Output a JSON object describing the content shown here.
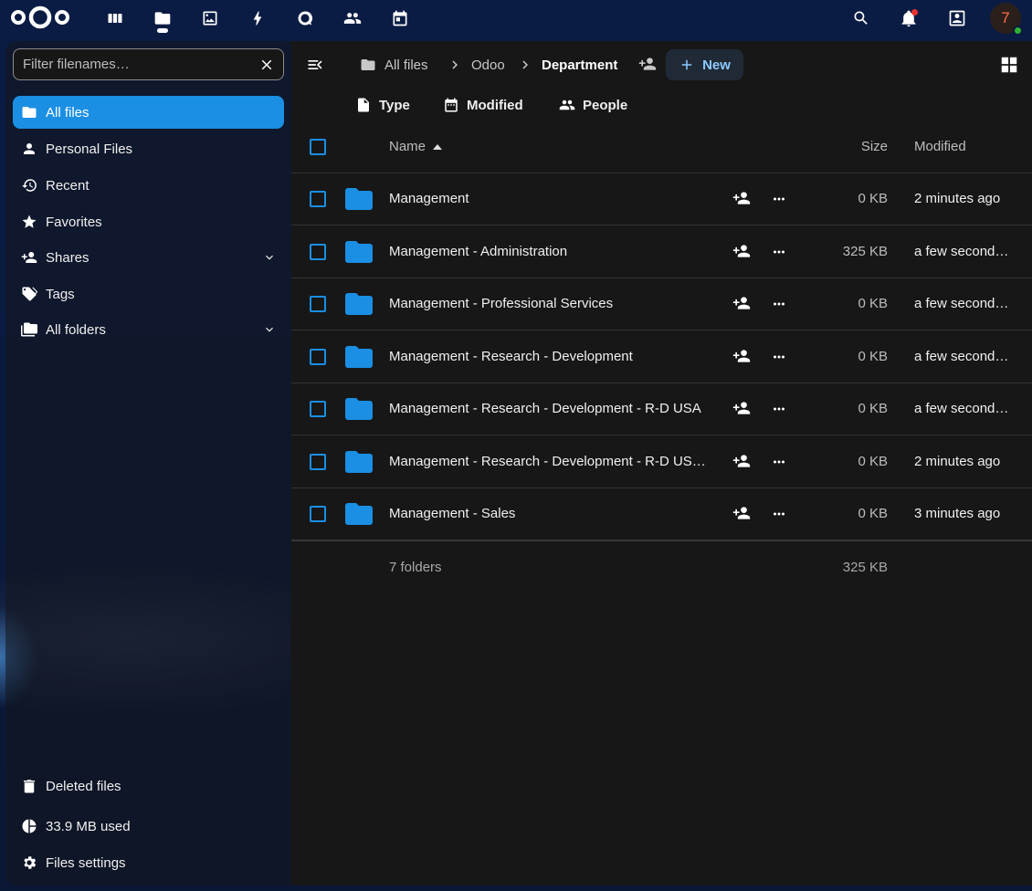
{
  "apps": [
    {
      "name": "dashboard"
    },
    {
      "name": "files"
    },
    {
      "name": "photos"
    },
    {
      "name": "activity"
    },
    {
      "name": "talk"
    },
    {
      "name": "contacts"
    },
    {
      "name": "calendar"
    }
  ],
  "header": {
    "avatar_initial": "7"
  },
  "sidebar": {
    "filter_placeholder": "Filter filenames…",
    "items": [
      {
        "label": "All files",
        "icon": "folder-icon",
        "active": true
      },
      {
        "label": "Personal Files",
        "icon": "account-icon"
      },
      {
        "label": "Recent",
        "icon": "history-icon"
      },
      {
        "label": "Favorites",
        "icon": "star-icon"
      },
      {
        "label": "Shares",
        "icon": "share-icon",
        "expandable": true
      },
      {
        "label": "Tags",
        "icon": "tag-icon"
      },
      {
        "label": "All folders",
        "icon": "folder-multiple-icon",
        "expandable": true
      }
    ],
    "bottom": {
      "deleted": "Deleted files",
      "quota": "33.9 MB used",
      "settings": "Files settings"
    }
  },
  "breadcrumb": {
    "root": "All files",
    "parent": "Odoo",
    "current": "Department"
  },
  "toolbar": {
    "new_label": "New"
  },
  "filters": {
    "type": "Type",
    "modified": "Modified",
    "people": "People"
  },
  "table": {
    "columns": {
      "name": "Name",
      "size": "Size",
      "modified": "Modified"
    },
    "rows": [
      {
        "name": "Management",
        "size": "0 KB",
        "modified": "2 minutes ago"
      },
      {
        "name": "Management - Administration",
        "size": "325 KB",
        "modified": "a few second…"
      },
      {
        "name": "Management - Professional Services",
        "size": "0 KB",
        "modified": "a few second…"
      },
      {
        "name": "Management - Research - Development",
        "size": "0 KB",
        "modified": "a few second…"
      },
      {
        "name": "Management - Research - Development - R-D USA",
        "size": "0 KB",
        "modified": "a few second…"
      },
      {
        "name": "Management - Research - Development - R-D US…",
        "size": "0 KB",
        "modified": "2 minutes ago"
      },
      {
        "name": "Management - Sales",
        "size": "0 KB",
        "modified": "3 minutes ago"
      }
    ],
    "summary": {
      "count": "7 folders",
      "total": "325 KB"
    }
  },
  "colors": {
    "accent": "#1a8fe3",
    "folder": "#1a8fe3",
    "notification_dot": "#e9322d",
    "status_online": "#2fb130"
  }
}
